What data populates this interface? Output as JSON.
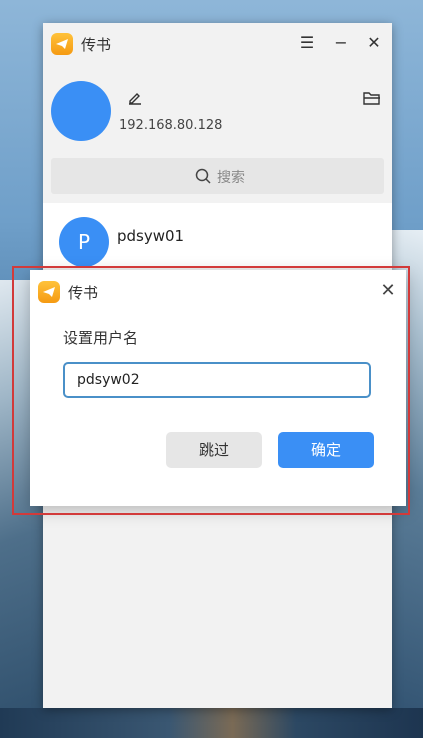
{
  "app": {
    "title": "传书"
  },
  "window_controls": {
    "menu": "☰",
    "minimize": "−",
    "close": "✕"
  },
  "profile": {
    "ip": "192.168.80.128"
  },
  "search": {
    "placeholder": "搜索"
  },
  "devices": [
    {
      "initial": "P",
      "name": "pdsyw01"
    }
  ],
  "dialog": {
    "title": "传书",
    "close": "✕",
    "label": "设置用户名",
    "input_value": "pdsyw02",
    "skip_label": "跳过",
    "confirm_label": "确定"
  },
  "colors": {
    "accent": "#3a8ff5",
    "highlight": "#d23a3a",
    "logo": "#f7a825"
  }
}
